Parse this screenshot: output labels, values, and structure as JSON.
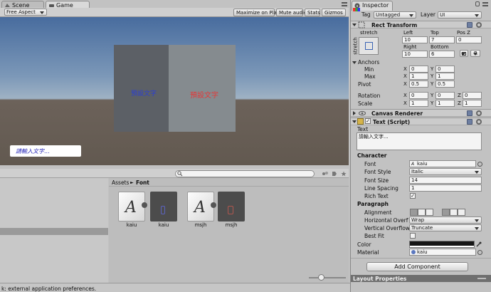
{
  "tabs": {
    "scene": "Scene",
    "game": "Game",
    "inspector": "Inspector"
  },
  "game_toolbar": {
    "aspect": "Free Aspect",
    "maximize": "Maximize on Play",
    "mute": "Mute audio",
    "stats": "Stats",
    "gizmos": "Gizmos"
  },
  "game_view": {
    "left_text": "預設文字",
    "right_text": "預設文字",
    "input_placeholder": "請輸入文字..."
  },
  "project": {
    "breadcrumb_root": "Assets",
    "breadcrumb_sep": "►",
    "breadcrumb_folder": "Font",
    "assets": [
      {
        "label": "kaiu",
        "kind": "font",
        "glyph": "A"
      },
      {
        "label": "kaiu",
        "kind": "material"
      },
      {
        "label": "msjh",
        "kind": "font",
        "glyph": "A"
      },
      {
        "label": "msjh",
        "kind": "material"
      }
    ]
  },
  "status_bar": "k: external application preferences.",
  "inspector": {
    "tag_label": "Tag",
    "tag_value": "Untagged",
    "layer_label": "Layer",
    "layer_value": "UI",
    "rect_transform": {
      "title": "Rect Transform",
      "stretch_top": "stretch",
      "stretch_side": "stretch",
      "left_label": "Left",
      "top_label": "Top",
      "posz_label": "Pos Z",
      "left": "10",
      "top": "7",
      "posz": "0",
      "right_label": "Right",
      "bottom_label": "Bottom",
      "right": "10",
      "bottom": "6",
      "r_button": "R",
      "anchors": "Anchors",
      "min": "Min",
      "max": "Max",
      "pivot": "Pivot",
      "min_x": "0",
      "min_y": "0",
      "max_x": "1",
      "max_y": "1",
      "pivot_x": "0.5",
      "pivot_y": "0.5",
      "rotation": "Rotation",
      "scale": "Scale",
      "rot_x": "0",
      "rot_y": "0",
      "rot_z": "0",
      "scale_x": "1",
      "scale_y": "1",
      "scale_z": "1",
      "x": "X",
      "y": "Y",
      "z": "Z"
    },
    "canvas_renderer": {
      "title": "Canvas Renderer"
    },
    "text_script": {
      "title": "Text (Script)",
      "text_label": "Text",
      "text_value": "請輸入文字...",
      "character": "Character",
      "font_label": "Font",
      "font_value": "kaiu",
      "font_style_label": "Font Style",
      "font_style_value": "Italic",
      "font_size_label": "Font Size",
      "font_size_value": "14",
      "line_spacing_label": "Line Spacing",
      "line_spacing_value": "1",
      "rich_text_label": "Rich Text",
      "paragraph": "Paragraph",
      "alignment_label": "Alignment",
      "h_overflow_label": "Horizontal Overflo",
      "h_overflow_value": "Wrap",
      "v_overflow_label": "Vertical Overflow",
      "v_overflow_value": "Truncate",
      "best_fit_label": "Best Fit",
      "color_label": "Color",
      "material_label": "Material",
      "material_value": "kaiu"
    },
    "add_component": "Add Component",
    "layout_properties": "Layout Properties"
  },
  "colors": {
    "game_sky_top": "#4d70a0",
    "game_ground": "#655a52",
    "left_panel": "#5c6066",
    "right_panel": "#858b8f",
    "left_text": "#2b3fd0",
    "right_text": "#e23a3a",
    "input_text": "#2727b8"
  }
}
